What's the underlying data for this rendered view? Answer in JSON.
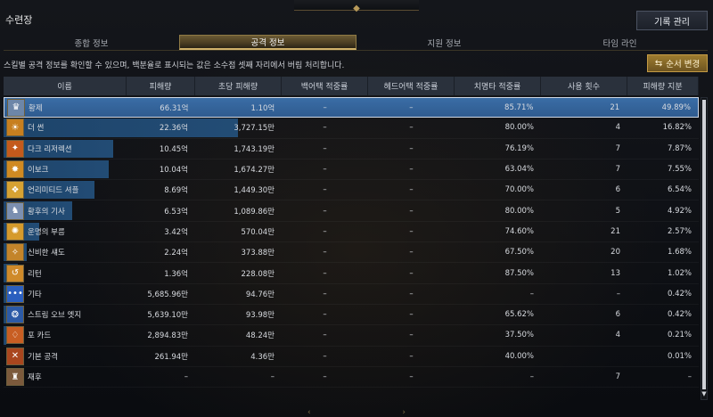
{
  "window": {
    "title": "수련장",
    "top_deco": "◆"
  },
  "header_actions": {
    "record_button": "기록 관리",
    "sort_button": "순서 변경",
    "sort_icon": "⇆"
  },
  "tabs": [
    {
      "label": "종합 정보",
      "active": false
    },
    {
      "label": "공격 정보",
      "active": true
    },
    {
      "label": "지원 정보",
      "active": false
    },
    {
      "label": "타임 라인",
      "active": false
    }
  ],
  "description": "스킬별 공격 정보를 확인할 수 있으며, 백분율로 표시되는 값은 소수점 셋째 자리에서 버림 처리합니다.",
  "columns": [
    "이름",
    "피해량",
    "초당 피해량",
    "백어택 적중률",
    "헤드어택 적중률",
    "치명타 적중률",
    "사용 횟수",
    "피해량 지분"
  ],
  "rows": [
    {
      "name": "황제",
      "icon": "emperor-icon",
      "glyph": "♛",
      "color": "#6d86a8",
      "damage": "66.31억",
      "dps": "1.10억",
      "back": "–",
      "head": "–",
      "crit": "85.71%",
      "uses": "21",
      "share": "49.89%",
      "share_val": 49.89,
      "highlight": true
    },
    {
      "name": "더 썬",
      "icon": "sun-card-icon",
      "glyph": "☀",
      "color": "#c77f1f",
      "damage": "22.36억",
      "dps": "3,727.15만",
      "back": "–",
      "head": "–",
      "crit": "80.00%",
      "uses": "4",
      "share": "16.82%",
      "share_val": 16.82
    },
    {
      "name": "다크 리저렉션",
      "icon": "dark-resurrection-icon",
      "glyph": "✦",
      "color": "#c45a1c",
      "damage": "10.45억",
      "dps": "1,743.19만",
      "back": "–",
      "head": "–",
      "crit": "76.19%",
      "uses": "7",
      "share": "7.87%",
      "share_val": 7.87
    },
    {
      "name": "이보크",
      "icon": "evoke-icon",
      "glyph": "✸",
      "color": "#d08a22",
      "damage": "10.04억",
      "dps": "1,674.27만",
      "back": "–",
      "head": "–",
      "crit": "63.04%",
      "uses": "7",
      "share": "7.55%",
      "share_val": 7.55
    },
    {
      "name": "언리미티드 셔플",
      "icon": "unlimited-shuffle-icon",
      "glyph": "❖",
      "color": "#d6a233",
      "damage": "8.69억",
      "dps": "1,449.30만",
      "back": "–",
      "head": "–",
      "crit": "70.00%",
      "uses": "6",
      "share": "6.54%",
      "share_val": 6.54
    },
    {
      "name": "황후의 기사",
      "icon": "empress-knight-icon",
      "glyph": "♞",
      "color": "#7b8fb0",
      "damage": "6.53억",
      "dps": "1,089.86만",
      "back": "–",
      "head": "–",
      "crit": "80.00%",
      "uses": "5",
      "share": "4.92%",
      "share_val": 4.92
    },
    {
      "name": "운명의 부름",
      "icon": "call-of-fate-icon",
      "glyph": "✺",
      "color": "#d59a2c",
      "damage": "3.42억",
      "dps": "570.04만",
      "back": "–",
      "head": "–",
      "crit": "74.60%",
      "uses": "21",
      "share": "2.57%",
      "share_val": 2.57
    },
    {
      "name": "신비한 섀도",
      "icon": "mystic-shadow-icon",
      "glyph": "✧",
      "color": "#c3842a",
      "damage": "2.24억",
      "dps": "373.88만",
      "back": "–",
      "head": "–",
      "crit": "67.50%",
      "uses": "20",
      "share": "1.68%",
      "share_val": 1.68
    },
    {
      "name": "리턴",
      "icon": "return-icon",
      "glyph": "↺",
      "color": "#cf8a2a",
      "damage": "1.36억",
      "dps": "228.08만",
      "back": "–",
      "head": "–",
      "crit": "87.50%",
      "uses": "13",
      "share": "1.02%",
      "share_val": 1.02
    },
    {
      "name": "기타",
      "icon": "misc-icon",
      "glyph": "•••",
      "color": "#2b5fbf",
      "damage": "5,685.96만",
      "dps": "94.76만",
      "back": "–",
      "head": "–",
      "crit": "–",
      "uses": "–",
      "share": "0.42%",
      "share_val": 0.42
    },
    {
      "name": "스트림 오브 엣지",
      "icon": "stream-of-edge-icon",
      "glyph": "❂",
      "color": "#2c5aa6",
      "damage": "5,639.10만",
      "dps": "93.98만",
      "back": "–",
      "head": "–",
      "crit": "65.62%",
      "uses": "6",
      "share": "0.42%",
      "share_val": 0.42
    },
    {
      "name": "포 카드",
      "icon": "four-card-icon",
      "glyph": "♢",
      "color": "#c85e23",
      "damage": "2,894.83만",
      "dps": "48.24만",
      "back": "–",
      "head": "–",
      "crit": "37.50%",
      "uses": "4",
      "share": "0.21%",
      "share_val": 0.21
    },
    {
      "name": "기본 공격",
      "icon": "basic-attack-icon",
      "glyph": "✕",
      "color": "#a9461e",
      "damage": "261.94만",
      "dps": "4.36만",
      "back": "–",
      "head": "–",
      "crit": "40.00%",
      "uses": "",
      "share": "0.01%",
      "share_val": 0.01
    },
    {
      "name": "재후",
      "icon": "misc-card-icon",
      "glyph": "♜",
      "color": "#7c5a3c",
      "damage": "–",
      "dps": "–",
      "back": "–",
      "head": "–",
      "crit": "–",
      "uses": "7",
      "share": "–",
      "share_val": 0
    }
  ],
  "bottom_nav": {
    "prev": "‹",
    "next": "›"
  }
}
